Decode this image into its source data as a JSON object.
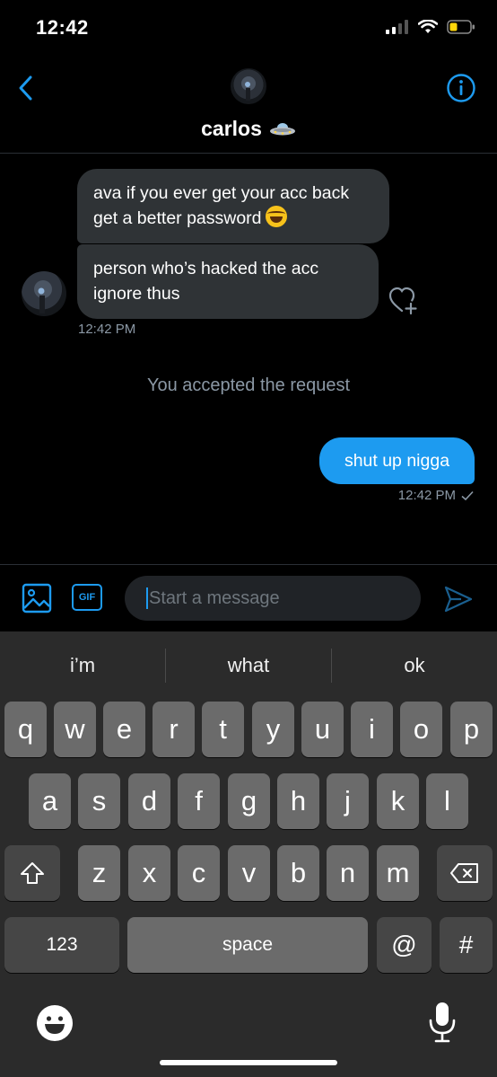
{
  "status_bar": {
    "time": "12:42"
  },
  "conversation": {
    "contact_name": "carlos",
    "contact_emoji_icon": "ufo-icon"
  },
  "messages": {
    "incoming_1": "ava if you ever get your acc back get a better password",
    "incoming_1_emoji_icon": "laughing-emoji-icon",
    "incoming_2": "person who’s hacked the acc ignore thus",
    "incoming_time": "12:42 PM",
    "system": "You accepted the request",
    "outgoing_1": "shut up nigga",
    "outgoing_time": "12:42 PM",
    "outgoing_status_icon": "check-icon"
  },
  "composer": {
    "placeholder": "Start a message",
    "gif_label": "GIF"
  },
  "keyboard": {
    "suggestions": [
      "i’m",
      "what",
      "ok"
    ],
    "row1": [
      "q",
      "w",
      "e",
      "r",
      "t",
      "y",
      "u",
      "i",
      "o",
      "p"
    ],
    "row2": [
      "a",
      "s",
      "d",
      "f",
      "g",
      "h",
      "j",
      "k",
      "l"
    ],
    "row3": [
      "z",
      "x",
      "c",
      "v",
      "b",
      "n",
      "m"
    ],
    "numbers_label": "123",
    "space_label": "space",
    "at_label": "@",
    "hash_label": "#"
  },
  "colors": {
    "accent": "#1d9bf0",
    "incoming_bubble": "#2f3336",
    "background": "#000000",
    "muted_text": "#8b98a5"
  }
}
